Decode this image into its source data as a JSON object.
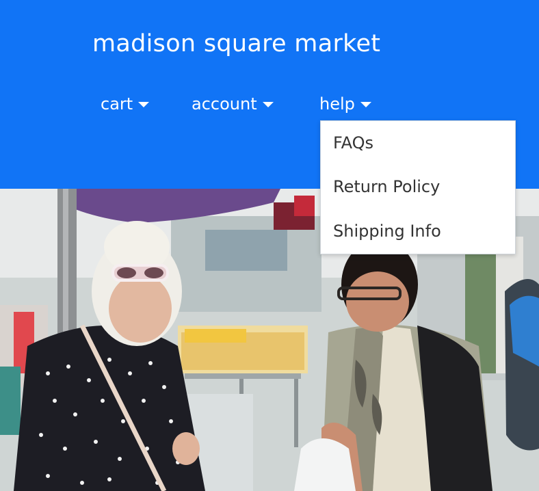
{
  "site": {
    "title": "madison square market"
  },
  "nav": {
    "items": [
      {
        "label": "cart",
        "icon": "caret-down-icon"
      },
      {
        "label": "account",
        "icon": "caret-down-icon"
      },
      {
        "label": "help",
        "icon": "caret-down-icon"
      }
    ]
  },
  "help_menu": {
    "items": [
      "FAQs",
      "Return Policy",
      "Shipping Info"
    ]
  },
  "colors": {
    "header_bg": "#1174f6",
    "header_text": "#ffffff",
    "menu_text": "#333333"
  }
}
